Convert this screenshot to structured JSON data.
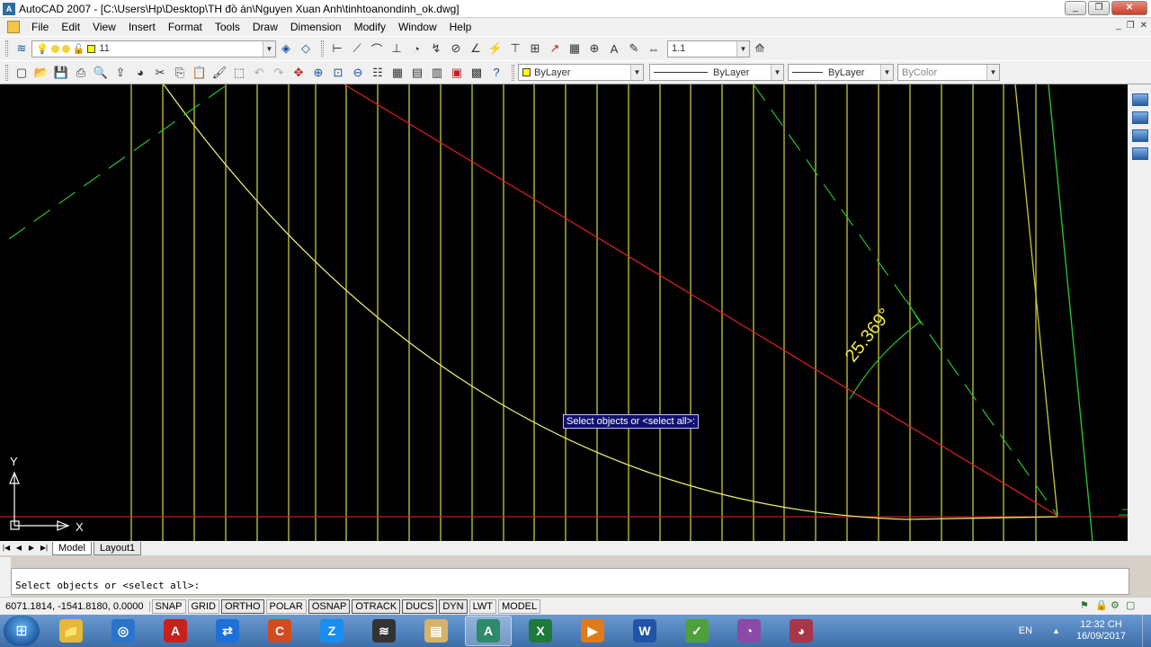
{
  "window": {
    "title": "AutoCAD 2007 - [C:\\Users\\Hp\\Desktop\\TH đồ án\\Nguyen Xuan Anh\\tinhtoanondinh_ok.dwg]",
    "app_icon_text": "A",
    "minimize": "_",
    "restore": "❐",
    "close": "✕"
  },
  "menu": {
    "items": [
      "File",
      "Edit",
      "View",
      "Insert",
      "Format",
      "Tools",
      "Draw",
      "Dimension",
      "Modify",
      "Window",
      "Help"
    ],
    "mdi_minimize": "_",
    "mdi_restore": "❐",
    "mdi_close": "✕"
  },
  "toolbar1": {
    "layer_value": "11",
    "dimstyle_value": "1.1"
  },
  "toolbar2": {
    "color_value": "ByLayer",
    "linetype_value": "ByLayer",
    "lineweight_value": "ByLayer",
    "plotstyle_value": "ByColor"
  },
  "canvas": {
    "background": "#000000",
    "angle_label": "25.369°",
    "ucs_x": "X",
    "ucs_y": "Y",
    "tooltip": "Select objects or <select all>:"
  },
  "tabs": {
    "model": "Model",
    "layout": "Layout1"
  },
  "command_line": {
    "text": "Select objects or <select all>:"
  },
  "status": {
    "coords": "6071.1814, -1541.8180, 0.0000",
    "toggles": [
      "SNAP",
      "GRID",
      "ORTHO",
      "POLAR",
      "OSNAP",
      "OTRACK",
      "DUCS",
      "DYN",
      "LWT",
      "MODEL"
    ]
  },
  "taskbar": {
    "language": "EN",
    "time": "12:32 CH",
    "date": "16/09/2017",
    "apps": [
      {
        "name": "file-explorer",
        "glyph": "📁",
        "color": "#e6b836"
      },
      {
        "name": "app-circle",
        "glyph": "◎",
        "color": "#2a74c9"
      },
      {
        "name": "autocad",
        "glyph": "A",
        "color": "#c8211b"
      },
      {
        "name": "teamviewer",
        "glyph": "⇄",
        "color": "#1c71d8"
      },
      {
        "name": "ccleaner",
        "glyph": "C",
        "color": "#d24a1e"
      },
      {
        "name": "zalo",
        "glyph": "Z",
        "color": "#1b8cf0"
      },
      {
        "name": "wifi",
        "glyph": "≋",
        "color": "#333333"
      },
      {
        "name": "folder",
        "glyph": "▤",
        "color": "#d7b36a"
      },
      {
        "name": "autocad-window",
        "glyph": "A",
        "color": "#2d8a6a"
      },
      {
        "name": "excel",
        "glyph": "X",
        "color": "#1d7a3a"
      },
      {
        "name": "media-player",
        "glyph": "▶",
        "color": "#e07a1a"
      },
      {
        "name": "word",
        "glyph": "W",
        "color": "#2154a8"
      },
      {
        "name": "evernote",
        "glyph": "✓",
        "color": "#4ea03a"
      },
      {
        "name": "gauge-app-1",
        "glyph": "◔",
        "color": "#8a4aa8"
      },
      {
        "name": "gauge-app-2",
        "glyph": "◕",
        "color": "#a8354a"
      }
    ]
  }
}
